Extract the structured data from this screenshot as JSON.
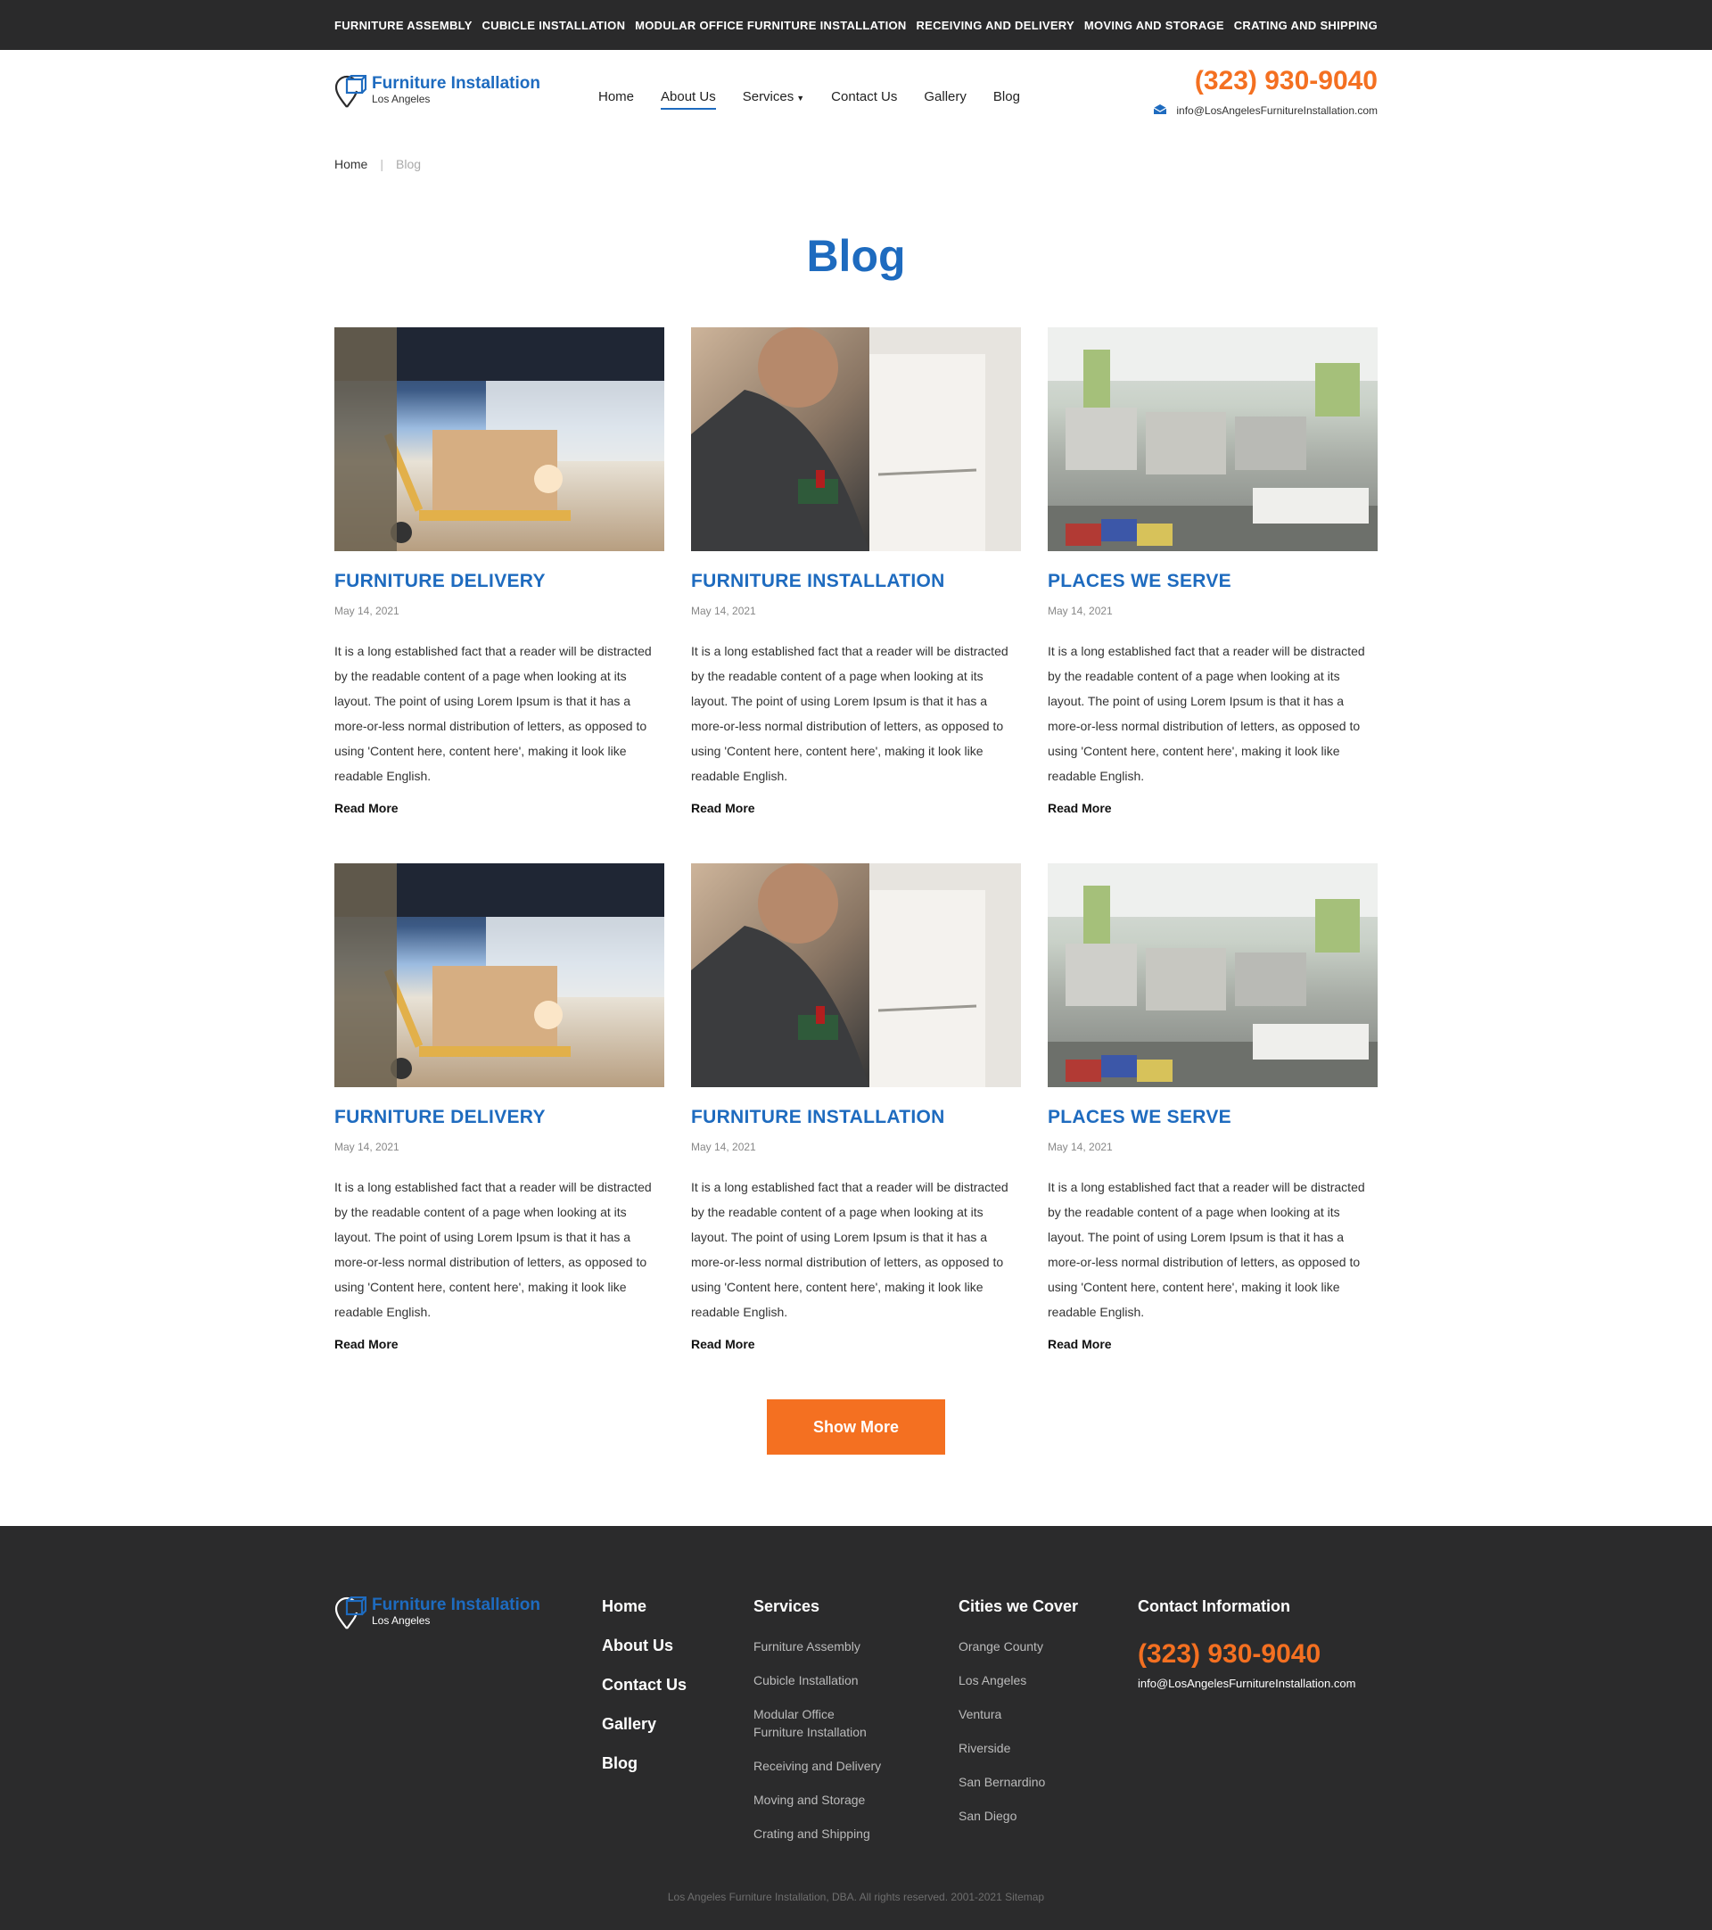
{
  "topbar": {
    "items": [
      "FURNITURE ASSEMBLY",
      "CUBICLE INSTALLATION",
      "MODULAR OFFICE FURNITURE INSTALLATION",
      "RECEIVING AND DELIVERY",
      "MOVING AND STORAGE",
      "CRATING AND SHIPPING"
    ]
  },
  "header": {
    "logo_title": "Furniture Installation",
    "logo_sub": "Los Angeles",
    "nav": [
      "Home",
      "About Us",
      "Services",
      "Contact Us",
      "Gallery",
      "Blog"
    ],
    "active_nav": "About Us",
    "phone": "(323) 930-9040",
    "email": "info@LosAngelesFurnitureInstallation.com"
  },
  "breadcrumb": {
    "home": "Home",
    "sep": "|",
    "current": "Blog"
  },
  "page_title": "Blog",
  "posts": [
    {
      "title": "FURNITURE DELIVERY",
      "date": "May 14, 2021",
      "image": "pallet-jack-truck",
      "text": "It is a long established fact that a reader will be distracted by the readable content of a page when looking at its layout. The point of using Lorem Ipsum is that it has a more-or-less normal distribution of letters, as opposed to using 'Content here, content here', making it look like readable English.",
      "more": "Read More"
    },
    {
      "title": "FURNITURE INSTALLATION",
      "date": "May 14, 2021",
      "image": "worker-drill-cabinet",
      "text": "It is a long established fact that a reader will be distracted by the readable content of a page when looking at its layout. The point of using Lorem Ipsum is that it has a more-or-less normal distribution of letters, as opposed to using 'Content here, content here', making it look like readable English.",
      "more": "Read More"
    },
    {
      "title": "PLACES WE SERVE",
      "date": "May 14, 2021",
      "image": "office-cubicles",
      "text": "It is a long established fact that a reader will be distracted by the readable content of a page when looking at its layout. The point of using Lorem Ipsum is that it has a more-or-less normal distribution of letters, as opposed to using 'Content here, content here', making it look like readable English.",
      "more": "Read More"
    },
    {
      "title": "FURNITURE DELIVERY",
      "date": "May 14, 2021",
      "image": "pallet-jack-truck",
      "text": "It is a long established fact that a reader will be distracted by the readable content of a page when looking at its layout. The point of using Lorem Ipsum is that it has a more-or-less normal distribution of letters, as opposed to using 'Content here, content here', making it look like readable English.",
      "more": "Read More"
    },
    {
      "title": "FURNITURE INSTALLATION",
      "date": "May 14, 2021",
      "image": "worker-drill-cabinet",
      "text": "It is a long established fact that a reader will be distracted by the readable content of a page when looking at its layout. The point of using Lorem Ipsum is that it has a more-or-less normal distribution of letters, as opposed to using 'Content here, content here', making it look like readable English.",
      "more": "Read More"
    },
    {
      "title": "PLACES WE SERVE",
      "date": "May 14, 2021",
      "image": "office-cubicles",
      "text": "It is a long established fact that a reader will be distracted by the readable content of a page when looking at its layout. The point of using Lorem Ipsum is that it has a more-or-less normal distribution of letters, as opposed to using 'Content here, content here', making it look like readable English.",
      "more": "Read More"
    }
  ],
  "show_more": "Show More",
  "footer": {
    "logo_title": "Furniture Installation",
    "logo_sub": "Los Angeles",
    "main_links": [
      "Home",
      "About Us",
      "Contact Us",
      "Gallery",
      "Blog"
    ],
    "services_head": "Services",
    "services": [
      "Furniture Assembly",
      "Cubicle Installation",
      "Modular Office Furniture Installation",
      "Receiving and Delivery",
      "Moving and Storage",
      "Crating and Shipping"
    ],
    "cities_head": "Cities we Cover",
    "cities": [
      "Orange County",
      "Los Angeles",
      "Ventura",
      "Riverside",
      "San Bernardino",
      "San Diego"
    ],
    "contact_head": "Contact Information",
    "phone": "(323) 930-9040",
    "email": "info@LosAngelesFurnitureInstallation.com",
    "copyright": "Los Angeles Furniture Installation, DBA. All rights reserved. 2001-2021 Sitemap"
  },
  "colors": {
    "brand_blue": "#1e6bbf",
    "accent_orange": "#f47021",
    "dark_bg": "#2a2a2b"
  }
}
